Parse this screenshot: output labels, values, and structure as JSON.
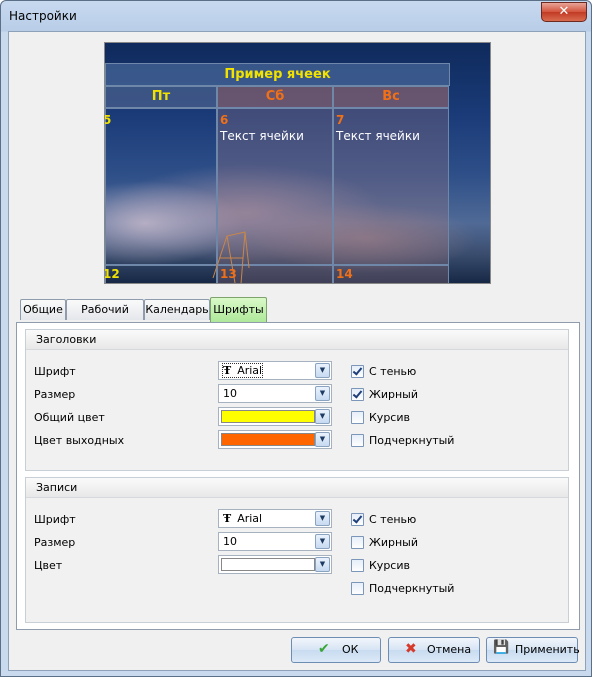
{
  "window": {
    "title": "Настройки",
    "close_glyph": "✕"
  },
  "preview": {
    "header": "Пример ячеек",
    "days": [
      "Пт",
      "Сб",
      "Вс"
    ],
    "cells": [
      {
        "num": "5",
        "text": ""
      },
      {
        "num": "6",
        "text": "Текст ячейки"
      },
      {
        "num": "7",
        "text": "Текст ячейки"
      },
      {
        "num": "12",
        "text": ""
      },
      {
        "num": "13",
        "text": ""
      },
      {
        "num": "14",
        "text": ""
      }
    ],
    "colors": {
      "header_text": "#f1e200",
      "weekday_text": "#f1e200",
      "weekend_text": "#f07018"
    }
  },
  "tabs": [
    "Общие",
    "Рабочий стол",
    "Календарь",
    "Шрифты"
  ],
  "active_tab": "Шрифты",
  "headers_group": {
    "title": "Заголовки",
    "font_label": "Шрифт",
    "font_value": "Arial",
    "size_label": "Размер",
    "size_value": "10",
    "common_color_label": "Общий цвет",
    "common_color": "#ffff00",
    "weekend_color_label": "Цвет выходных",
    "weekend_color": "#ff6600",
    "shadow_label": "С тенью",
    "shadow_checked": true,
    "bold_label": "Жирный",
    "bold_checked": true,
    "italic_label": "Курсив",
    "italic_checked": false,
    "underline_label": "Подчеркнутый",
    "underline_checked": false
  },
  "records_group": {
    "title": "Записи",
    "font_label": "Шрифт",
    "font_value": "Arial",
    "size_label": "Размер",
    "size_value": "10",
    "color_label": "Цвет",
    "color": "#ffffff",
    "shadow_label": "С тенью",
    "shadow_checked": true,
    "bold_label": "Жирный",
    "bold_checked": false,
    "italic_label": "Курсив",
    "italic_checked": false,
    "underline_label": "Подчеркнутый",
    "underline_checked": false
  },
  "buttons": {
    "ok": "ОК",
    "cancel": "Отмена",
    "apply": "Применить"
  },
  "icons": {
    "dropdown_arrow": "▼",
    "font_icon": "Ŧ",
    "ok_icon": "✔",
    "cancel_icon": "✖",
    "apply_icon": "💾"
  }
}
